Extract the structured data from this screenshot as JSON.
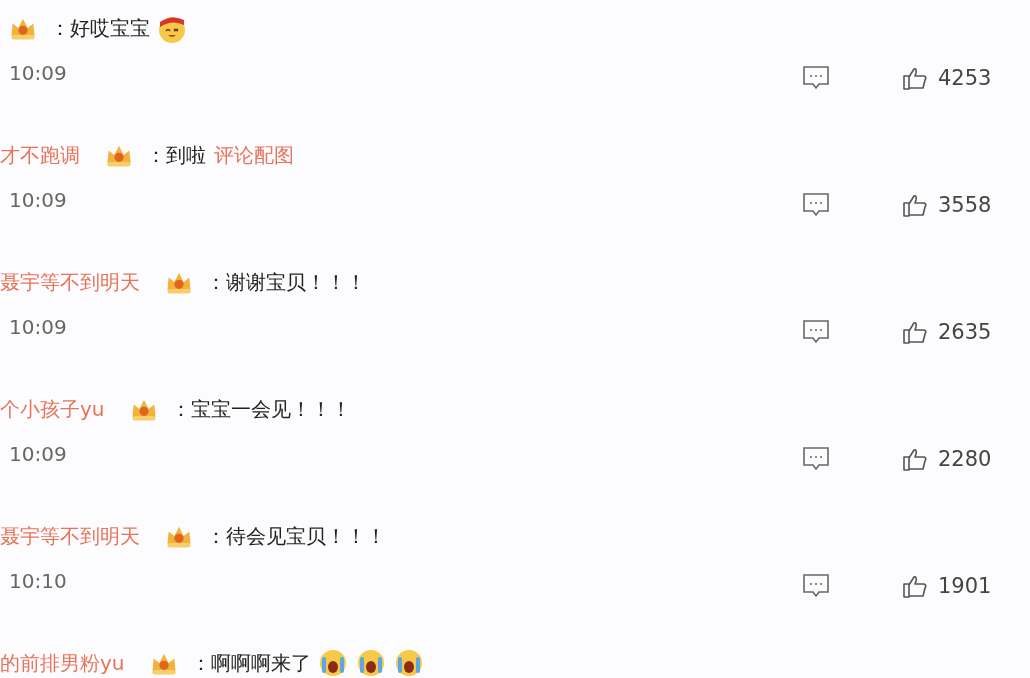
{
  "comments": [
    {
      "content": "：好哎宝宝",
      "emojis": [
        {
          "kind": "headband"
        }
      ],
      "time": "10:09",
      "likes": "4253"
    },
    {
      "username": "才不跑调",
      "content": "：到啦",
      "link": "评论配图",
      "time": "10:09",
      "likes": "3558"
    },
    {
      "username": "聂宇等不到明天",
      "content": "：谢谢宝贝！！！",
      "time": "10:09",
      "likes": "2635"
    },
    {
      "username": "个小孩子yu",
      "content": "：宝宝一会见！！！",
      "time": "10:09",
      "likes": "2280"
    },
    {
      "username": "聂宇等不到明天",
      "content": "：待会见宝贝！！！",
      "time": "10:10",
      "likes": "1901"
    },
    {
      "username": "的前排男粉yu",
      "content": "：啊啊啊来了",
      "emojis": [
        {
          "kind": "crying"
        },
        {
          "kind": "crying"
        },
        {
          "kind": "crying"
        }
      ]
    }
  ]
}
